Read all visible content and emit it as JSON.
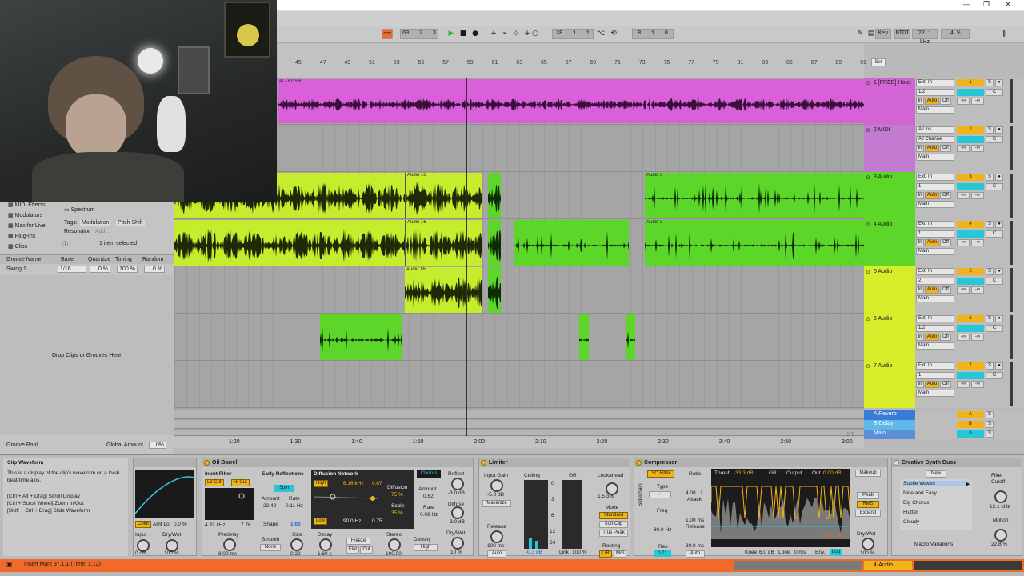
{
  "titlebar": {
    "window_controls": [
      "—",
      "❐",
      "✕"
    ]
  },
  "transport": {
    "tempo_box": "60 . 2 . 3",
    "position": "38 . 1 . 1",
    "loop_length": "8 . 1 . 0",
    "key_label": "Key",
    "midi_label": "MIDI",
    "sample_rate": "22.1 kHz",
    "cpu": "4 %"
  },
  "arrangement": {
    "bar_numbers": [
      "45",
      "47",
      "49",
      "51",
      "53",
      "55",
      "57",
      "59",
      "61",
      "63",
      "65",
      "67",
      "69",
      "71",
      "73",
      "75",
      "77",
      "79",
      "81",
      "83",
      "85",
      "87",
      "89",
      "91"
    ],
    "time_marks": [
      "1:20",
      "1:30",
      "1:40",
      "1:50",
      "2:00",
      "2:10",
      "2:20",
      "2:30",
      "2:40",
      "2:50",
      "3:00"
    ],
    "set_button": "Set",
    "zoom_page": "1/1",
    "zoom_pct": "100%",
    "tracks": [
      {
        "name": "1 [FREE] Hous",
        "input": "Ext. In",
        "channel": "1/2",
        "num": "1",
        "color": "#d264d4",
        "clip_label": "at - RUSH"
      },
      {
        "name": "2 MIDI",
        "input": "All Ins",
        "channel": "All Channe",
        "num": "2",
        "color": "#c27ad0"
      },
      {
        "name": "3 Audio",
        "input": "Ext. In",
        "channel": "1",
        "num": "3",
        "color": "#5cd628",
        "clip_label": "Audio 16",
        "clip_label2": "Audio 3"
      },
      {
        "name": "4 Audio",
        "input": "Ext. In",
        "channel": "1",
        "num": "4",
        "color": "#5cd628",
        "clip_label": "Audio 16",
        "clip_label2": "Audio 3"
      },
      {
        "name": "5 Audio",
        "input": "Ext. In",
        "channel": "2",
        "num": "5",
        "color": "#d9ec2a",
        "clip_label": "Audio 16"
      },
      {
        "name": "6 Audio",
        "input": "Ext. In",
        "channel": "1/2",
        "num": "6",
        "color": "#d9ec2a"
      },
      {
        "name": "7 Audio",
        "input": "Ext. In",
        "channel": "1",
        "num": "7",
        "color": "#d9ec2a"
      }
    ],
    "return_tracks": [
      {
        "name": "A Reverb",
        "num": "A",
        "color": "#3a7bd5"
      },
      {
        "name": "B Delay",
        "num": "B",
        "color": "#5fb8e8"
      },
      {
        "name": "Main",
        "num": "0",
        "color": "#5b8fd8"
      }
    ],
    "io_labels": {
      "in": "In",
      "auto": "Auto",
      "off": "Off",
      "main": "Main",
      "s": "S",
      "c": "C",
      "inf": "-∞"
    }
  },
  "browser": {
    "categories": [
      "MIDI Effects",
      "Modulators",
      "Max for Live",
      "Plug-Ins",
      "Clips"
    ],
    "selected_item": "Spectrum",
    "tags_label": "Tags:",
    "tags": [
      "Modulation",
      "Pitch Shift",
      "Resonator",
      "Add..."
    ],
    "items_selected": "1 item selected",
    "groove_headers": [
      "Groove Name",
      "Base",
      "Quantize",
      "Timing",
      "Random"
    ],
    "groove_row": [
      "Swing 1...",
      "1/16",
      "0 %",
      "100 %",
      "0 %"
    ],
    "drop_text": "Drop Clips or Grooves Here",
    "groove_pool": "Groove Pool",
    "global_amount": "Global Amount",
    "global_amount_val": "0%"
  },
  "info": {
    "title": "Clip Waveform",
    "body": "This is a display of the clip's waveform on a local beat-time axis.",
    "shortcut1": "[Ctrl + Alt + Drag] Scroll Display",
    "shortcut2": "[Ctrl + Scroll Wheel] Zoom In/Out",
    "shortcut3": "[Shift + Ctrl + Drag] Slide Waveform"
  },
  "devices": {
    "oil_barrel": {
      "title": "Oil Barrel",
      "input_filter": "Input Filter",
      "lo_cut": "Lo Cut",
      "hi_cut": "Hi Cut",
      "freq_lo": "4.32 kHz",
      "freq_hi": "7.76",
      "early_refl": "Early Reflections",
      "spin": "Spin",
      "amount_lbl": "Amount",
      "rate_lbl": "Rate",
      "amount_val": "22.42",
      "rate_val": "0.11 Hz",
      "shape_lbl": "Shape",
      "shape_val": "1.00",
      "diffusion_net": "Diffusion Network",
      "high_btn": "High",
      "freq_net": "6.16 kHz",
      "net_val": "0.67",
      "diffusion_lbl": "Diffusion",
      "diffusion_val": "75 %",
      "scale_lbl": "Scale",
      "scale_val": "35 %",
      "low_btn": "Low",
      "low_freq": "90.0 Hz",
      "low_val": "0.75",
      "chorus": "Chorus",
      "chorus_amount": "Amount",
      "chorus_amount_val": "0.62",
      "chorus_rate": "Rate",
      "chorus_rate_val": "0.09 Hz",
      "predelay_lbl": "Predelay",
      "predelay_val": "8.00 ms",
      "smooth_lbl": "Smooth",
      "smooth_val": "None",
      "size_lbl": "Size",
      "size_val": "0.22",
      "decay_lbl": "Decay",
      "decay_val": "1.60 s",
      "freeze": "Freeze",
      "flat": "Flat",
      "cut": "Cut",
      "stereo_lbl": "Stereo",
      "stereo_val": "100.00",
      "density_lbl": "Density",
      "density_val": "High",
      "reflect_lbl": "Reflect",
      "reflect_val": "-3.0 dB",
      "diffuse_lbl": "Diffuse",
      "diffuse_val": "-3.0 dB",
      "drywet_lbl": "Dry/Wet",
      "drywet_val": "10 %",
      "input_lbl": "Input",
      "input_val": "0 dB",
      "amtlo_lbl": "Amt Lo",
      "amtlo_val": "0.0 %",
      "color_lbl": "Color",
      "dw2_lbl": "Dry/Wet",
      "dw2_val": "100 %"
    },
    "limiter": {
      "title": "Limiter",
      "input_gain": "Input Gain",
      "input_gain_val": "-5.0 dB",
      "maximize": "Maximize",
      "ceiling": "Ceiling",
      "gr": "GR",
      "scale": [
        "0",
        "3",
        "6",
        "12",
        "24"
      ],
      "ceiling_val": "-0.3 dB",
      "link_lbl": "Link",
      "link_val": "100 %",
      "release_lbl": "Release",
      "release_val": "100 ms",
      "auto": "Auto",
      "lookahead_lbl": "Lookahead",
      "lookahead_scale": "1.5  3  6",
      "mode_lbl": "Mode",
      "mode_standard": "Standard",
      "mode_soft": "Soft Clip",
      "mode_true": "True Peak",
      "routing_lbl": "Routing",
      "routing_lr": "L/R",
      "routing_ms": "M/S"
    },
    "compressor": {
      "title": "Compressor",
      "sc_filter": "SC Filter",
      "type_lbl": "Type",
      "freq_lbl": "Freq",
      "freq_val": "80.0 Hz",
      "res_lbl": "Res",
      "res_val": "0.71",
      "ratio_lbl": "Ratio",
      "ratio_val": "4.00 : 1",
      "attack_lbl": "Attack",
      "attack_val": "1.00 ms",
      "release_lbl": "Release",
      "release_val": "30.0 ms",
      "auto": "Auto",
      "thresh": "Thresh",
      "thresh_val": "-33.3 dB",
      "gr": "GR",
      "output": "Output",
      "out": "Out",
      "out_val": "0.00 dB",
      "thresh_line": "-5.73 dB",
      "knee_lbl": "Knee",
      "knee_val": "6.0 dB",
      "look_lbl": "Look.",
      "look_val": "0 ms",
      "env_lbl": "Env.",
      "env_val": "Log",
      "makeup": "Makeup",
      "peak": "Peak",
      "rms": "RMS",
      "expand": "Expand",
      "dw_lbl": "Dry/Wet",
      "dw_val": "100 %",
      "sidechain": "Sidechain"
    },
    "synth_buss": {
      "title": "Creative Synth Buss",
      "new": "New",
      "presets": [
        "Subtle Waves",
        "Nice and Easy",
        "Big Chorus",
        "Flutter",
        "Cloudy"
      ],
      "macro": "Macro Variations",
      "filter_cutoff": "Filter Cutoff",
      "cutoff_val": "12.1 kHz",
      "motion": "Motion",
      "motion_val": "22.8 %"
    }
  },
  "status": {
    "message": "Insert Mark 37.1.1 (Time: 1:12)",
    "track": "4-Audio"
  }
}
